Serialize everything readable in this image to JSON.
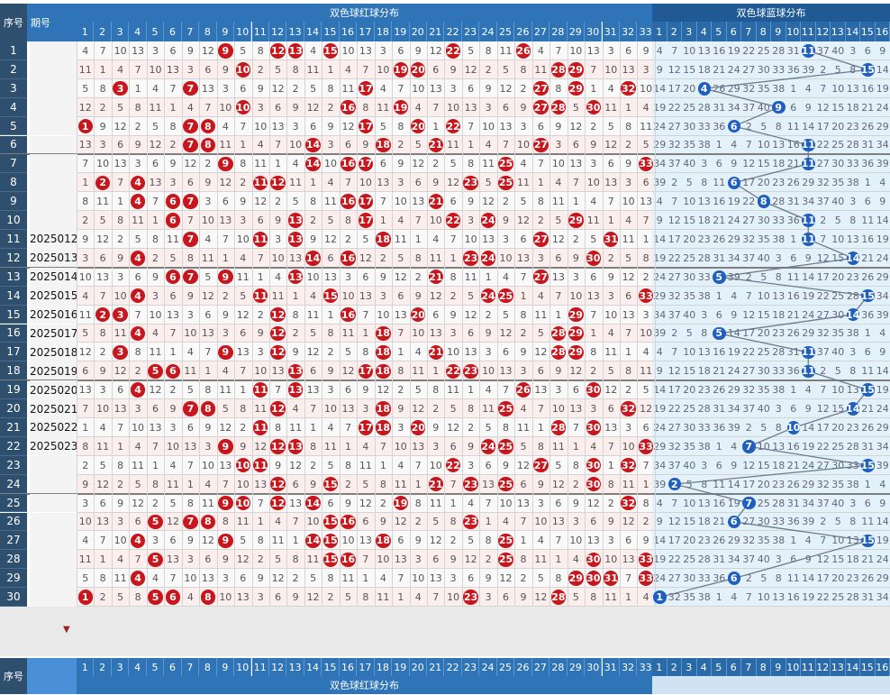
{
  "header": {
    "seq_label": "序号",
    "issue_label": "期号",
    "red_title": "双色球红球分布",
    "blue_title": "双色球蓝球分布"
  },
  "colors": {
    "red_ball": "#c8161d",
    "blue_ball": "#1f5fbf",
    "header_blue": "#2f74b6",
    "red_bg_odd": "#f6f6f6",
    "red_bg_even": "#fdeaea",
    "blue_bg": "#e3f1fb"
  },
  "red_numbers": [
    "1",
    "2",
    "3",
    "4",
    "5",
    "6",
    "7",
    "8",
    "9",
    "10",
    "11",
    "12",
    "13",
    "14",
    "15",
    "16",
    "17",
    "18",
    "19",
    "20",
    "21",
    "22",
    "23",
    "24",
    "25",
    "26",
    "27",
    "28",
    "29",
    "30",
    "31",
    "32",
    "33"
  ],
  "blue_numbers": [
    "1",
    "2",
    "3",
    "4",
    "5",
    "6",
    "7",
    "8",
    "9",
    "10",
    "11",
    "12",
    "13",
    "14",
    "15",
    "16"
  ],
  "rows": [
    {
      "seq": "1",
      "issue": "",
      "red": [
        1,
        2,
        3,
        4,
        5,
        6,
        7,
        8,
        9,
        10,
        11,
        12,
        13,
        14,
        15,
        16,
        17,
        18,
        19,
        20,
        21,
        22,
        23,
        24,
        25,
        26,
        27,
        28,
        29,
        30,
        31,
        32,
        33
      ],
      "hits": [
        9,
        12,
        13,
        15,
        22,
        26
      ],
      "blue_hit": 11
    },
    {
      "seq": "2",
      "issue": "",
      "hits": [
        10,
        19,
        20,
        28,
        29
      ],
      "blue_hit": 15
    },
    {
      "seq": "3",
      "issue": "",
      "hits": [
        3,
        7,
        17,
        27,
        29,
        32
      ],
      "blue_hit": 4
    },
    {
      "seq": "4",
      "issue": "",
      "hits": [
        10,
        16,
        19,
        27,
        28,
        30
      ],
      "blue_hit": 9
    },
    {
      "seq": "5",
      "issue": "",
      "hits": [
        1,
        7,
        8,
        17,
        20,
        22
      ],
      "blue_hit": 6
    },
    {
      "seq": "6",
      "issue": "",
      "hits": [
        7,
        8,
        14,
        18,
        21,
        27
      ],
      "blue_hit": 11
    },
    {
      "seq": "7",
      "issue": "",
      "hits": [
        9,
        14,
        16,
        17,
        25,
        33
      ],
      "blue_hit": 11
    },
    {
      "seq": "8",
      "issue": "",
      "hits": [
        2,
        4,
        11,
        12,
        23,
        25
      ],
      "blue_hit": 6
    },
    {
      "seq": "9",
      "issue": "",
      "hits": [
        4,
        6,
        7,
        16,
        17,
        21
      ],
      "blue_hit": 8
    },
    {
      "seq": "10",
      "issue": "",
      "hits": [
        6,
        13,
        17,
        22,
        24,
        29
      ],
      "blue_hit": 11
    },
    {
      "seq": "11",
      "issue": "2025012",
      "hits": [
        7,
        11,
        13,
        18,
        27,
        31
      ],
      "blue_hit": 11
    },
    {
      "seq": "12",
      "issue": "2025013",
      "hits": [
        4,
        14,
        16,
        23,
        24,
        30
      ],
      "blue_hit": 14
    },
    {
      "seq": "13",
      "issue": "2025014",
      "hits": [
        6,
        7,
        9,
        13,
        21,
        27
      ],
      "blue_hit": 5
    },
    {
      "seq": "14",
      "issue": "2025015",
      "hits": [
        4,
        11,
        15,
        24,
        25,
        33
      ],
      "blue_hit": 15
    },
    {
      "seq": "15",
      "issue": "2025016",
      "hits": [
        2,
        3,
        12,
        16,
        20,
        29
      ],
      "blue_hit": 14
    },
    {
      "seq": "16",
      "issue": "2025017",
      "hits": [
        4,
        12,
        18,
        28,
        29
      ],
      "blue_hit": 5
    },
    {
      "seq": "17",
      "issue": "2025018",
      "hits": [
        3,
        9,
        12,
        18,
        21,
        28,
        29
      ],
      "blue_hit": 11
    },
    {
      "seq": "18",
      "issue": "2025019",
      "hits": [
        5,
        6,
        13,
        17,
        18,
        22,
        23
      ],
      "blue_hit": 11
    },
    {
      "seq": "19",
      "issue": "2025020",
      "hits": [
        4,
        11,
        13,
        26,
        30
      ],
      "blue_hit": 15
    },
    {
      "seq": "20",
      "issue": "2025021",
      "hits": [
        7,
        8,
        12,
        18,
        25,
        32
      ],
      "blue_hit": 14
    },
    {
      "seq": "21",
      "issue": "2025022",
      "hits": [
        11,
        17,
        18,
        20,
        28,
        30
      ],
      "blue_hit": 10
    },
    {
      "seq": "22",
      "issue": "2025023",
      "hits": [
        9,
        12,
        13,
        24,
        25,
        33
      ],
      "blue_hit": 7
    },
    {
      "seq": "23",
      "issue": "",
      "hits": [
        10,
        11,
        22,
        27,
        30,
        32
      ],
      "blue_hit": 15
    },
    {
      "seq": "24",
      "issue": "",
      "hits": [
        12,
        15,
        21,
        23,
        25,
        30
      ],
      "blue_hit": 2
    },
    {
      "seq": "25",
      "issue": "",
      "hits": [
        9,
        10,
        12,
        14,
        19,
        32
      ],
      "blue_hit": 7
    },
    {
      "seq": "26",
      "issue": "",
      "hits": [
        5,
        7,
        8,
        15,
        16,
        23
      ],
      "blue_hit": 6
    },
    {
      "seq": "27",
      "issue": "",
      "hits": [
        4,
        9,
        14,
        15,
        18,
        25
      ],
      "blue_hit": 15
    },
    {
      "seq": "28",
      "issue": "",
      "hits": [
        5,
        15,
        16,
        25,
        30,
        33
      ],
      "blue_hit": 0
    },
    {
      "seq": "29",
      "issue": "",
      "hits": [
        4,
        29,
        30,
        31,
        33
      ],
      "blue_hit": 6
    },
    {
      "seq": "30",
      "issue": "",
      "hits": [
        1,
        5,
        6,
        8,
        23,
        28
      ],
      "blue_hit": 1
    }
  ],
  "footer": {
    "seq_label": "序号",
    "red_title": "双色球红球分布"
  }
}
